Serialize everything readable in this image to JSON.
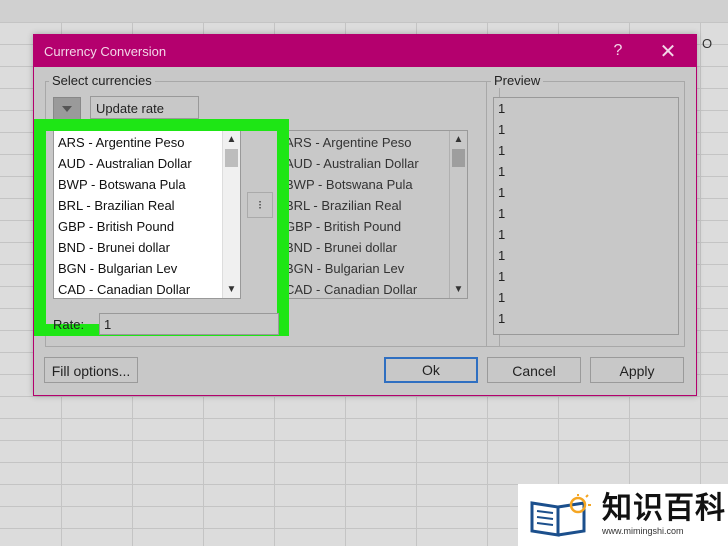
{
  "sheet": {
    "column_letter": "O"
  },
  "dialog": {
    "title": "Currency Conversion",
    "help": "?",
    "close": "✕",
    "select_group_label": "Select currencies",
    "preview_group_label": "Preview",
    "update_rate_label": "Update rate",
    "rate_label": "Rate:",
    "rate_value": "1",
    "currencies_left": [
      "ARS - Argentine Peso",
      "AUD - Australian Dollar",
      "BWP - Botswana Pula",
      "BRL - Brazilian Real",
      "GBP - British Pound",
      "BND - Brunei dollar",
      "BGN - Bulgarian Lev",
      "CAD - Canadian Dollar"
    ],
    "currencies_right": [
      "ARS - Argentine Peso",
      "AUD - Australian Dollar",
      "BWP - Botswana Pula",
      "BRL - Brazilian Real",
      "GBP - British Pound",
      "BND - Brunei dollar",
      "BGN - Bulgarian Lev",
      "CAD - Canadian Dollar"
    ],
    "preview_values": [
      "1",
      "1",
      "1",
      "1",
      "1",
      "1",
      "1",
      "1",
      "1",
      "1",
      "1"
    ],
    "buttons": {
      "fill_options": "Fill options...",
      "ok": "Ok",
      "cancel": "Cancel",
      "apply": "Apply"
    },
    "highlight_color": "#1ee615",
    "accent_color": "#b4006e"
  },
  "watermark": {
    "text": "知识百科",
    "url": "www.mimingshi.com"
  }
}
